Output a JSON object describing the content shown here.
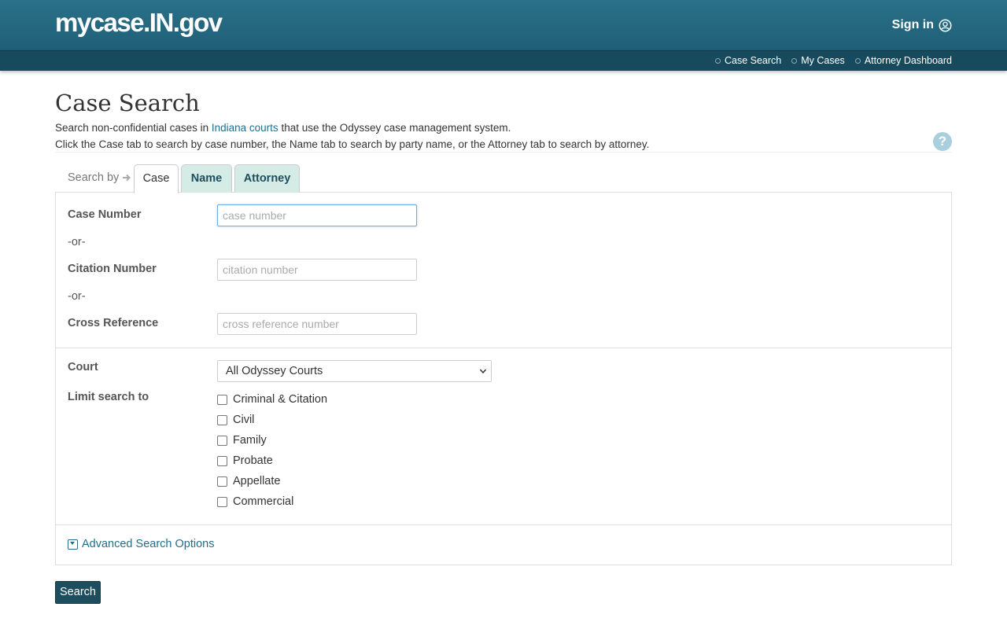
{
  "header": {
    "logo": "mycase.IN.gov",
    "sign_in": "Sign in",
    "nav": [
      {
        "label": "Case Search"
      },
      {
        "label": "My Cases"
      },
      {
        "label": "Attorney Dashboard"
      }
    ]
  },
  "page": {
    "title": "Case Search",
    "intro_line1_prefix": "Search non-confidential cases in ",
    "intro_link": "Indiana courts",
    "intro_line1_suffix": " that use the Odyssey case management system.",
    "intro_line2": "Click the Case tab to search by case number, the Name tab to search by party name, or the Attorney tab to search by attorney.",
    "help": "?"
  },
  "tabs": {
    "search_by": "Search by",
    "items": [
      {
        "label": "Case",
        "active": true
      },
      {
        "label": "Name",
        "active": false
      },
      {
        "label": "Attorney",
        "active": false
      }
    ]
  },
  "form": {
    "case_number_label": "Case Number",
    "case_number_placeholder": "case number",
    "or1": "-or-",
    "citation_label": "Citation Number",
    "citation_placeholder": "citation number",
    "or2": "-or-",
    "cross_ref_label": "Cross Reference",
    "cross_ref_placeholder": "cross reference number",
    "court_label": "Court",
    "court_value": "All Odyssey Courts",
    "limit_label": "Limit search to",
    "limit_options": [
      {
        "label": "Criminal & Citation",
        "checked": false
      },
      {
        "label": "Civil",
        "checked": false
      },
      {
        "label": "Family",
        "checked": false
      },
      {
        "label": "Probate",
        "checked": false
      },
      {
        "label": "Appellate",
        "checked": false
      },
      {
        "label": "Commercial",
        "checked": false
      }
    ],
    "advanced": "Advanced Search Options",
    "search_button": "Search"
  },
  "colors": {
    "header": "#236a82",
    "nav_bar": "#174a5c",
    "link": "#1f6f8b",
    "tab_inactive": "#d5ebe6",
    "button": "#1d4e5e"
  }
}
